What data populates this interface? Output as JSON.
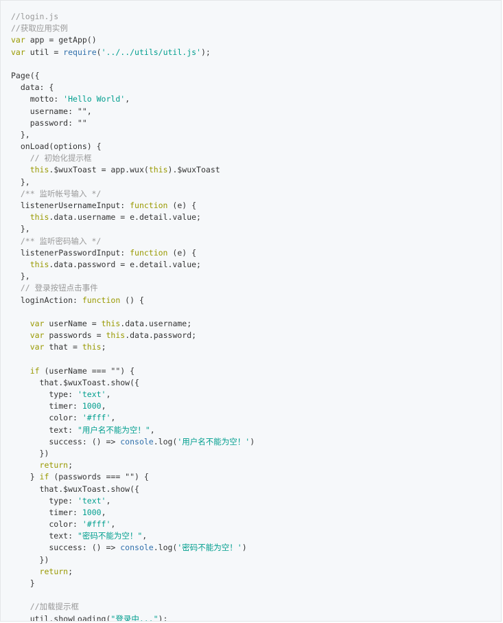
{
  "code": {
    "lines": [
      [
        [
          "c",
          "//login.js"
        ]
      ],
      [
        [
          "c",
          "//获取应用实例"
        ]
      ],
      [
        [
          "k",
          "var"
        ],
        [
          "p",
          " app = getApp()"
        ]
      ],
      [
        [
          "k",
          "var"
        ],
        [
          "p",
          " util = "
        ],
        [
          "b",
          "require"
        ],
        [
          "p",
          "("
        ],
        [
          "s",
          "'../../utils/util.js'"
        ],
        [
          "p",
          ");"
        ]
      ],
      [],
      [
        [
          "p",
          "Page({"
        ]
      ],
      [
        [
          "p",
          "  data: {"
        ]
      ],
      [
        [
          "p",
          "    motto: "
        ],
        [
          "s",
          "'Hello World'"
        ],
        [
          "p",
          ","
        ]
      ],
      [
        [
          "p",
          "    username: \"\","
        ]
      ],
      [
        [
          "p",
          "    password: \"\""
        ]
      ],
      [
        [
          "p",
          "  },"
        ]
      ],
      [
        [
          "p",
          "  onLoad(options) {"
        ]
      ],
      [
        [
          "c",
          "    // 初始化提示框"
        ]
      ],
      [
        [
          "p",
          "    "
        ],
        [
          "k",
          "this"
        ],
        [
          "p",
          ".$wuxToast = app.wux("
        ],
        [
          "k",
          "this"
        ],
        [
          "p",
          ").$wuxToast"
        ]
      ],
      [
        [
          "p",
          "  },"
        ]
      ],
      [
        [
          "c",
          "  /** 监听帐号输入 */"
        ]
      ],
      [
        [
          "p",
          "  listenerUsernameInput: "
        ],
        [
          "k",
          "function"
        ],
        [
          "p",
          " (e) {"
        ]
      ],
      [
        [
          "p",
          "    "
        ],
        [
          "k",
          "this"
        ],
        [
          "p",
          ".data.username = e.detail.value;"
        ]
      ],
      [
        [
          "p",
          "  },"
        ]
      ],
      [
        [
          "c",
          "  /** 监听密码输入 */"
        ]
      ],
      [
        [
          "p",
          "  listenerPasswordInput: "
        ],
        [
          "k",
          "function"
        ],
        [
          "p",
          " (e) {"
        ]
      ],
      [
        [
          "p",
          "    "
        ],
        [
          "k",
          "this"
        ],
        [
          "p",
          ".data.password = e.detail.value;"
        ]
      ],
      [
        [
          "p",
          "  },"
        ]
      ],
      [
        [
          "c",
          "  // 登录按钮点击事件"
        ]
      ],
      [
        [
          "p",
          "  loginAction: "
        ],
        [
          "k",
          "function"
        ],
        [
          "p",
          " () {"
        ]
      ],
      [],
      [
        [
          "p",
          "    "
        ],
        [
          "k",
          "var"
        ],
        [
          "p",
          " userName = "
        ],
        [
          "k",
          "this"
        ],
        [
          "p",
          ".data.username;"
        ]
      ],
      [
        [
          "p",
          "    "
        ],
        [
          "k",
          "var"
        ],
        [
          "p",
          " passwords = "
        ],
        [
          "k",
          "this"
        ],
        [
          "p",
          ".data.password;"
        ]
      ],
      [
        [
          "p",
          "    "
        ],
        [
          "k",
          "var"
        ],
        [
          "p",
          " that = "
        ],
        [
          "k",
          "this"
        ],
        [
          "p",
          ";"
        ]
      ],
      [],
      [
        [
          "p",
          "    "
        ],
        [
          "k",
          "if"
        ],
        [
          "p",
          " (userName === \"\") {"
        ]
      ],
      [
        [
          "p",
          "      that.$wuxToast.show({"
        ]
      ],
      [
        [
          "p",
          "        type: "
        ],
        [
          "s",
          "'text'"
        ],
        [
          "p",
          ","
        ]
      ],
      [
        [
          "p",
          "        timer: "
        ],
        [
          "n",
          "1000"
        ],
        [
          "p",
          ","
        ]
      ],
      [
        [
          "p",
          "        color: "
        ],
        [
          "s",
          "'#fff'"
        ],
        [
          "p",
          ","
        ]
      ],
      [
        [
          "p",
          "        text: "
        ],
        [
          "s",
          "\"用户名不能为空！\""
        ],
        [
          "p",
          ","
        ]
      ],
      [
        [
          "p",
          "        success: () => "
        ],
        [
          "b",
          "console"
        ],
        [
          "p",
          ".log("
        ],
        [
          "s",
          "'用户名不能为空！'"
        ],
        [
          "p",
          ")"
        ]
      ],
      [
        [
          "p",
          "      })"
        ]
      ],
      [
        [
          "p",
          "      "
        ],
        [
          "k",
          "return"
        ],
        [
          "p",
          ";"
        ]
      ],
      [
        [
          "p",
          "    } "
        ],
        [
          "k",
          "if"
        ],
        [
          "p",
          " (passwords === \"\") {"
        ]
      ],
      [
        [
          "p",
          "      that.$wuxToast.show({"
        ]
      ],
      [
        [
          "p",
          "        type: "
        ],
        [
          "s",
          "'text'"
        ],
        [
          "p",
          ","
        ]
      ],
      [
        [
          "p",
          "        timer: "
        ],
        [
          "n",
          "1000"
        ],
        [
          "p",
          ","
        ]
      ],
      [
        [
          "p",
          "        color: "
        ],
        [
          "s",
          "'#fff'"
        ],
        [
          "p",
          ","
        ]
      ],
      [
        [
          "p",
          "        text: "
        ],
        [
          "s",
          "\"密码不能为空！\""
        ],
        [
          "p",
          ","
        ]
      ],
      [
        [
          "p",
          "        success: () => "
        ],
        [
          "b",
          "console"
        ],
        [
          "p",
          ".log("
        ],
        [
          "s",
          "'密码不能为空！'"
        ],
        [
          "p",
          ")"
        ]
      ],
      [
        [
          "p",
          "      })"
        ]
      ],
      [
        [
          "p",
          "      "
        ],
        [
          "k",
          "return"
        ],
        [
          "p",
          ";"
        ]
      ],
      [
        [
          "p",
          "    }"
        ]
      ],
      [],
      [
        [
          "c",
          "    //加载提示框"
        ]
      ],
      [
        [
          "p",
          "    util.showLoading("
        ],
        [
          "s",
          "\"登录中...\""
        ],
        [
          "p",
          ");"
        ]
      ]
    ]
  },
  "colors": {
    "background": "#f6f8fa",
    "border": "#e4e6e9",
    "plain": "#333333",
    "comment": "#999999",
    "keyword": "#999900",
    "string": "#009e8e",
    "builtin": "#2f6fab"
  }
}
